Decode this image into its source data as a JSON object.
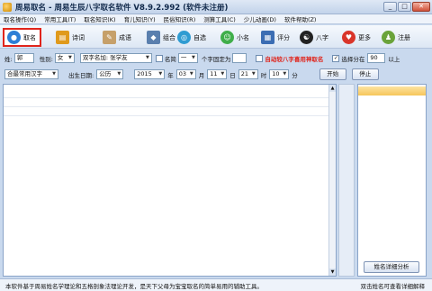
{
  "window": {
    "title": "周易取名 - 周易生辰八字取名软件 V8.9.2.992 (软件未注册)",
    "controls": [
      "_",
      "□",
      "✕"
    ]
  },
  "menu": [
    "取名操作(Q)",
    "常用工具(T)",
    "取名知识(K)",
    "育儿知识(Y)",
    "民俗知识(R)",
    "测算工具(C)",
    "少儿动画(D)",
    "软件帮助(Z)"
  ],
  "toolbar": [
    {
      "label": "取名",
      "icon": "globe-icon",
      "color": "#2d7fd6",
      "active": true
    },
    {
      "label": "诗词",
      "icon": "book-icon",
      "color": "#e09a1c"
    },
    {
      "label": "成语",
      "icon": "pencil-icon",
      "color": "#c6a06a"
    },
    {
      "label": "组合",
      "icon": "puzzle-icon",
      "color": "#5a7fae"
    },
    {
      "label": "自选",
      "icon": "magnifier-icon",
      "color": "#2f9cd2"
    },
    {
      "label": "小名",
      "icon": "person-icon",
      "color": "#3fae4a"
    },
    {
      "label": "评分",
      "icon": "notebook-icon",
      "color": "#3b6db3"
    },
    {
      "label": "八字",
      "icon": "taiji-icon",
      "color": "#222222"
    },
    {
      "label": "更多",
      "icon": "heart-icon",
      "color": "#d9352a"
    },
    {
      "label": "注册",
      "icon": "user-icon",
      "color": "#6aa33a"
    }
  ],
  "form": {
    "surname_label": "姓:",
    "surname_value": "郭",
    "gender_label": "性别:",
    "gender_value": "女",
    "double_char_value": "双字名加: 张学友",
    "ming_label": "名简",
    "ming_value": "一",
    "fixed_char_label": "个字固定为",
    "fixed_char_value": "",
    "auto_fortune_label": "自动较八字喜用神取名",
    "score_filter_label": "选择分在",
    "score_filter_value": "90",
    "score_filter_suffix": "以上",
    "charset_value": "合最常用汉字",
    "birth_label": "出生日期:",
    "calendar_value": "公历",
    "year_value": "2015",
    "year_label": "年",
    "month_value": "03",
    "month_label": "月",
    "day_value": "11",
    "day_label": "日",
    "hour_value": "21",
    "hour_label": "时",
    "minute_value": "10",
    "minute_label": "分",
    "start_button": "开始",
    "stop_button": "停止"
  },
  "results": {
    "detail_button": "姓名详细分析"
  },
  "status": {
    "left": "本软件基于周易姓名学理论和五格剖象法理论开发，是天下父母为宝宝取名的简单易用的辅助工具。",
    "right": "双击姓名可查看详细解释"
  }
}
